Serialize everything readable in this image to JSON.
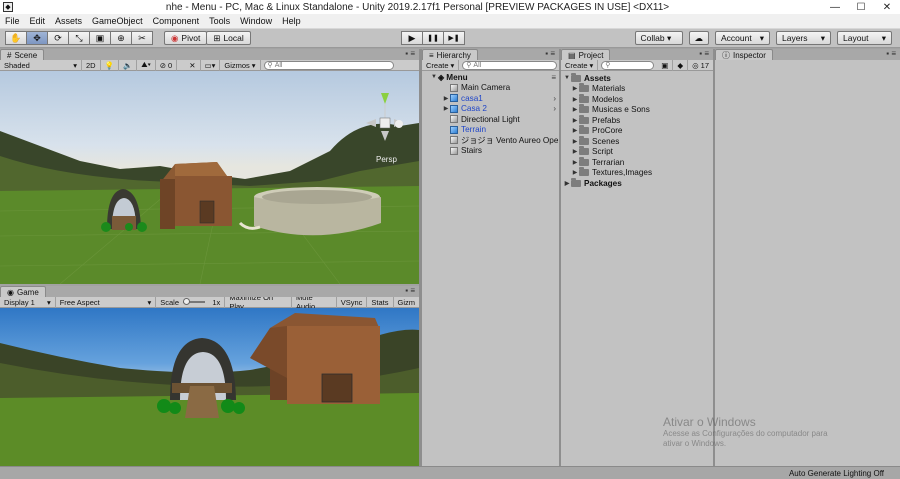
{
  "window": {
    "title": "nhe - Menu - PC, Mac & Linux Standalone - Unity 2019.2.17f1 Personal [PREVIEW PACKAGES IN USE] <DX11>",
    "minimize": "—",
    "maximize": "☐",
    "close": "✕"
  },
  "menu": [
    "File",
    "Edit",
    "Assets",
    "GameObject",
    "Component",
    "Tools",
    "Window",
    "Help"
  ],
  "toolbar": {
    "tools": [
      {
        "name": "hand-icon",
        "glyph": "✋"
      },
      {
        "name": "move-icon",
        "glyph": "✥"
      },
      {
        "name": "rotate-icon",
        "glyph": "⟳"
      },
      {
        "name": "scale-icon",
        "glyph": "⤡"
      },
      {
        "name": "rect-icon",
        "glyph": "▣"
      },
      {
        "name": "transform-icon",
        "glyph": "⊕"
      },
      {
        "name": "custom-tool-icon",
        "glyph": "✂"
      }
    ],
    "pivot_label": "Pivot",
    "local_label": "Local",
    "play_glyph": "▶",
    "pause_glyph": "❚❚",
    "step_glyph": "▶❚",
    "collab_label": "Collab ▾",
    "cloud_glyph": "☁",
    "account_label": "Account",
    "layers_label": "Layers",
    "layout_label": "Layout"
  },
  "scene": {
    "tab_label": "Scene",
    "shading_label": "Shaded",
    "mode_2d": "2D",
    "fx_count": "0",
    "gizmos_label": "Gizmos",
    "search_placeholder": "All",
    "persp_label": "Persp"
  },
  "game": {
    "tab_label": "Game",
    "display_label": "Display 1",
    "aspect_label": "Free Aspect",
    "scale_label": "Scale",
    "scale_value": "1x",
    "maximize_label": "Maximize On Play",
    "mute_label": "Mute Audio",
    "vsync_label": "VSync",
    "stats_label": "Stats",
    "gizmos_label": "Gizm"
  },
  "hierarchy": {
    "tab_label": "Hierarchy",
    "create_label": "Create",
    "search_placeholder": "All",
    "scene_name": "Menu",
    "items": [
      {
        "label": "Main Camera",
        "blue": false,
        "has_children": false
      },
      {
        "label": "casa1",
        "blue": true,
        "has_children": true
      },
      {
        "label": "Casa 2",
        "blue": true,
        "has_children": true
      },
      {
        "label": "Directional Light",
        "blue": false,
        "has_children": false
      },
      {
        "label": "Terrain",
        "blue": true,
        "has_children": false
      },
      {
        "label": "ジョジョ Vento Aureo Ope",
        "blue": false,
        "has_children": false
      },
      {
        "label": "Stairs",
        "blue": false,
        "has_children": false
      }
    ]
  },
  "project": {
    "tab_label": "Project",
    "create_label": "Create",
    "count_label": "17",
    "assets_label": "Assets",
    "folders": [
      "Materials",
      "Modelos",
      "Musicas e Sons",
      "Prefabs",
      "ProCore",
      "Scenes",
      "Script",
      "Terrarian",
      "Textures,Images"
    ],
    "packages_label": "Packages"
  },
  "inspector": {
    "tab_label": "Inspector"
  },
  "watermark": {
    "title": "Ativar o Windows",
    "line1": "Acesse as Configurações do computador para",
    "line2": "ativar o Windows."
  },
  "status": {
    "text": "Auto Generate Lighting Off"
  },
  "colors": {
    "terrain": "#5e8a2c",
    "house": "#9c6238",
    "hill": "#3a4a26",
    "selection": "#7d96c2"
  }
}
